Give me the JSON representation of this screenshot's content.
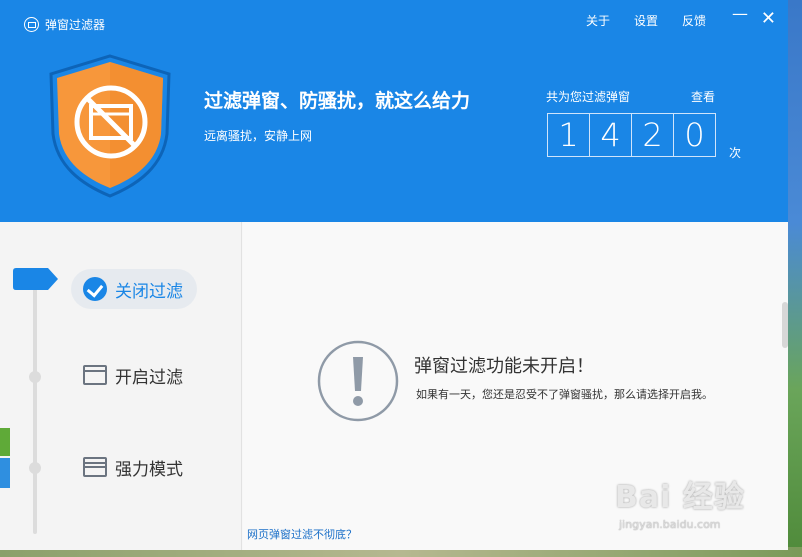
{
  "window": {
    "app_title": "弹窗过滤器",
    "menu": [
      "关于",
      "设置",
      "反馈"
    ],
    "minimize_label": "—",
    "close_label": "✕"
  },
  "header": {
    "headline": "过滤弹窗、防骚扰，就这么给力",
    "subline": "远离骚扰，安静上网",
    "counter_label": "共为您过滤弹窗",
    "view_link": "查看",
    "digits": [
      "1",
      "4",
      "2",
      "0"
    ],
    "unit": "次"
  },
  "sidebar": {
    "items": [
      {
        "label": "关闭过滤",
        "active": true
      },
      {
        "label": "开启过滤",
        "active": false
      },
      {
        "label": "强力模式",
        "active": false
      }
    ]
  },
  "content": {
    "status_title": "弹窗过滤功能未开启！",
    "status_desc": "如果有一天，您还是忍受不了弹窗骚扰，那么请选择开启我。",
    "bottom_link": "网页弹窗过滤不彻底？"
  },
  "watermark": {
    "main": "Bai 经验",
    "sub": "jingyan.baidu.com"
  },
  "colors": {
    "brand_blue": "#1a86e6",
    "shield_orange": "#f7973b"
  }
}
